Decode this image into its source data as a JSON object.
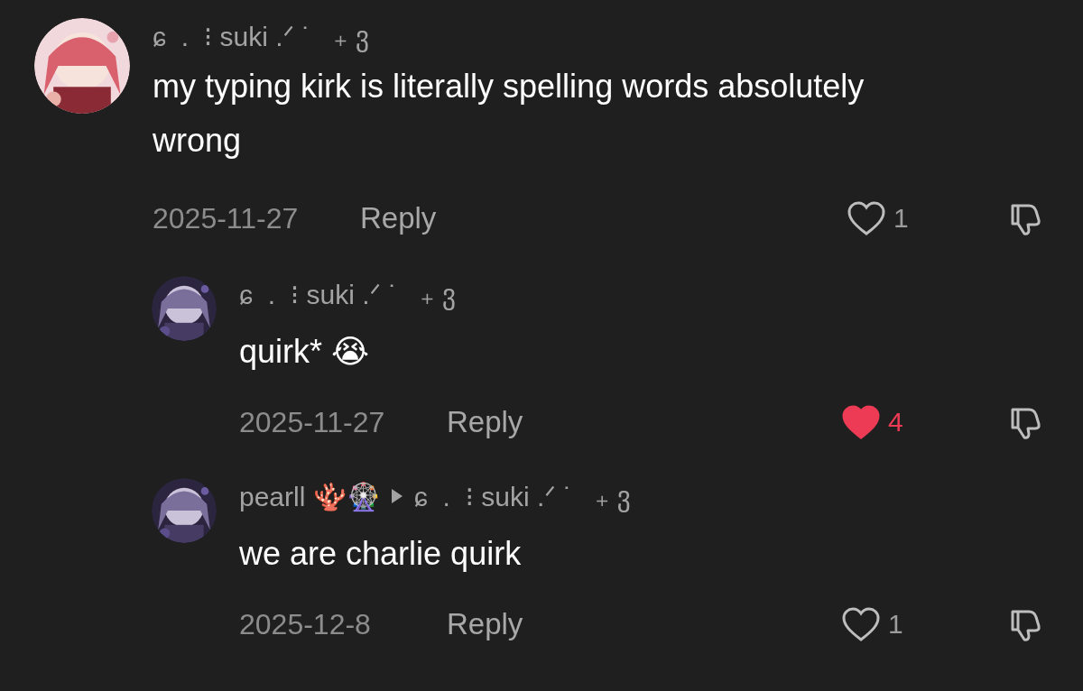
{
  "comments": [
    {
      "name": "ɕ  .  ⁝ suki .ᐟ ˙   ₊ ვ",
      "text": "my typing kirk is literally spelling words absolutely wrong",
      "date": "2025-11-27",
      "reply_label": "Reply",
      "liked": false,
      "likes": "1",
      "children": [
        {
          "name": "ɕ  .  ⁝ suki .ᐟ ˙   ₊ ვ",
          "text": "quirk* 😭",
          "date": "2025-11-27",
          "reply_label": "Reply",
          "liked": true,
          "likes": "4"
        },
        {
          "name": "pearll 🪸🎡",
          "reply_to": "ɕ  .  ⁝ suki .ᐟ ˙   ₊ ვ",
          "text": "we are charlie quirk",
          "date": "2025-12-8",
          "reply_label": "Reply",
          "liked": false,
          "likes": "1"
        }
      ]
    }
  ]
}
